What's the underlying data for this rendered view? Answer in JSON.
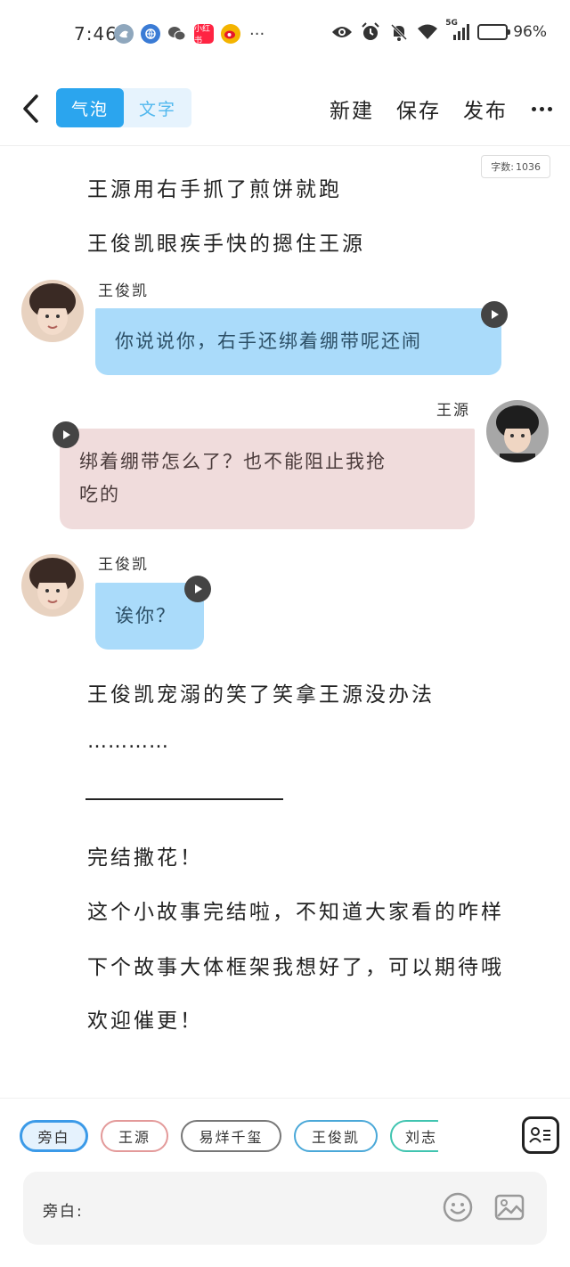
{
  "status_bar": {
    "time": "7:46",
    "app_badge": "小红书",
    "more_dots": "···",
    "network": "5G",
    "battery_percent": "96%",
    "battery_level": 0.96
  },
  "header": {
    "tabs": [
      "气泡",
      "文字"
    ],
    "new_label": "新建",
    "save_label": "保存",
    "publish_label": "发布"
  },
  "word_count": {
    "label": "字数:",
    "value": "1036"
  },
  "story": {
    "line1": "王源用右手抓了煎饼就跑",
    "line2": "王俊凯眼疾手快的摁住王源",
    "msg1": {
      "speaker": "王俊凯",
      "text": "你说说你，右手还绑着绷带呢还闹"
    },
    "msg2": {
      "speaker": "王源",
      "text1": "绑着绷带怎么了？也不能阻止我抢",
      "text2": "吃的"
    },
    "msg3": {
      "speaker": "王俊凯",
      "text": "诶你？"
    },
    "line3": "王俊凯宠溺的笑了笑拿王源没办法",
    "ellipsis": "…………",
    "end1": "完结撒花！",
    "end2": "这个小故事完结啦，不知道大家看的咋样",
    "end3": "下个故事大体框架我想好了，可以期待哦",
    "end4": "欢迎催更！"
  },
  "characters": [
    "旁白",
    "王源",
    "易烊千玺",
    "王俊凯",
    "刘志"
  ],
  "input": {
    "label": "旁白:",
    "value": ""
  },
  "colors": {
    "accent": "#2ba5ee",
    "blue_bubble": "#aadbfa",
    "pink_bubble": "#f0dcdc"
  }
}
